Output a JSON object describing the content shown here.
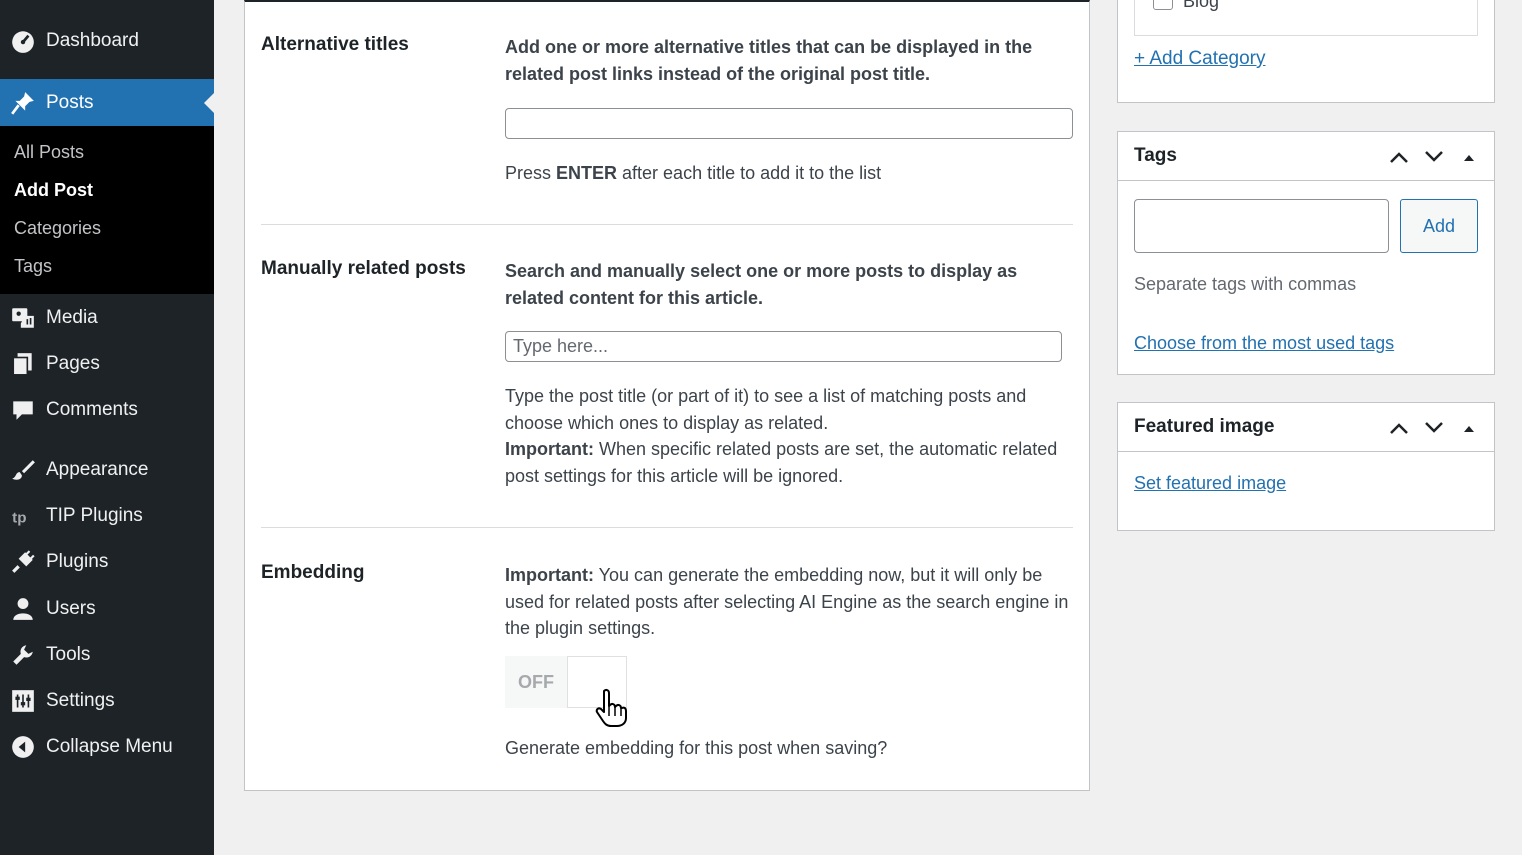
{
  "sidebar": {
    "items": [
      {
        "label": "Dashboard",
        "icon": "dashboard-icon"
      },
      {
        "label": "Posts",
        "icon": "pin-icon",
        "active": true
      },
      {
        "label": "Media",
        "icon": "media-icon"
      },
      {
        "label": "Pages",
        "icon": "pages-icon"
      },
      {
        "label": "Comments",
        "icon": "comments-icon"
      },
      {
        "label": "Appearance",
        "icon": "brush-icon"
      },
      {
        "label": "TIP Plugins",
        "icon": "tip-icon"
      },
      {
        "label": "Plugins",
        "icon": "plugin-icon"
      },
      {
        "label": "Users",
        "icon": "user-icon"
      },
      {
        "label": "Tools",
        "icon": "wrench-icon"
      },
      {
        "label": "Settings",
        "icon": "settings-icon"
      },
      {
        "label": "Collapse Menu",
        "icon": "collapse-icon"
      }
    ],
    "submenu": [
      "All Posts",
      "Add Post",
      "Categories",
      "Tags"
    ]
  },
  "main": {
    "alt_titles": {
      "label": "Alternative titles",
      "description": "Add one or more alternative titles that can be displayed in the related post links instead of the original post title.",
      "input_value": "",
      "help_pre": "Press ",
      "help_key": "ENTER",
      "help_post": " after each title to add it to the list"
    },
    "manual_related": {
      "label": "Manually related posts",
      "description": "Search and manually select one or more posts to display as related content for this article.",
      "placeholder": "Type here...",
      "help": "Type the post title (or part of it) to see a list of matching posts and choose which ones to display as related.",
      "important_label": "Important:",
      "important_text": " When specific related posts are set, the automatic related post settings for this article will be ignored."
    },
    "embedding": {
      "label": "Embedding",
      "important_label": "Important:",
      "important_text": " You can generate the embedding now, but it will only be used for related posts after selecting AI Engine as the search engine in the plugin settings.",
      "toggle_state": "OFF",
      "toggle_on": false,
      "help": "Generate embedding for this post when saving?"
    }
  },
  "categories_box": {
    "partial_item": "Blog",
    "add_link": "+ Add Category"
  },
  "tags_box": {
    "title": "Tags",
    "add_button": "Add",
    "help": "Separate tags with commas",
    "choose_link": "Choose from the most used tags"
  },
  "featured_box": {
    "title": "Featured image",
    "set_link": "Set featured image"
  },
  "colors": {
    "sidebar_bg": "#1d2327",
    "active_bg": "#2271b1",
    "link": "#2271b1"
  }
}
